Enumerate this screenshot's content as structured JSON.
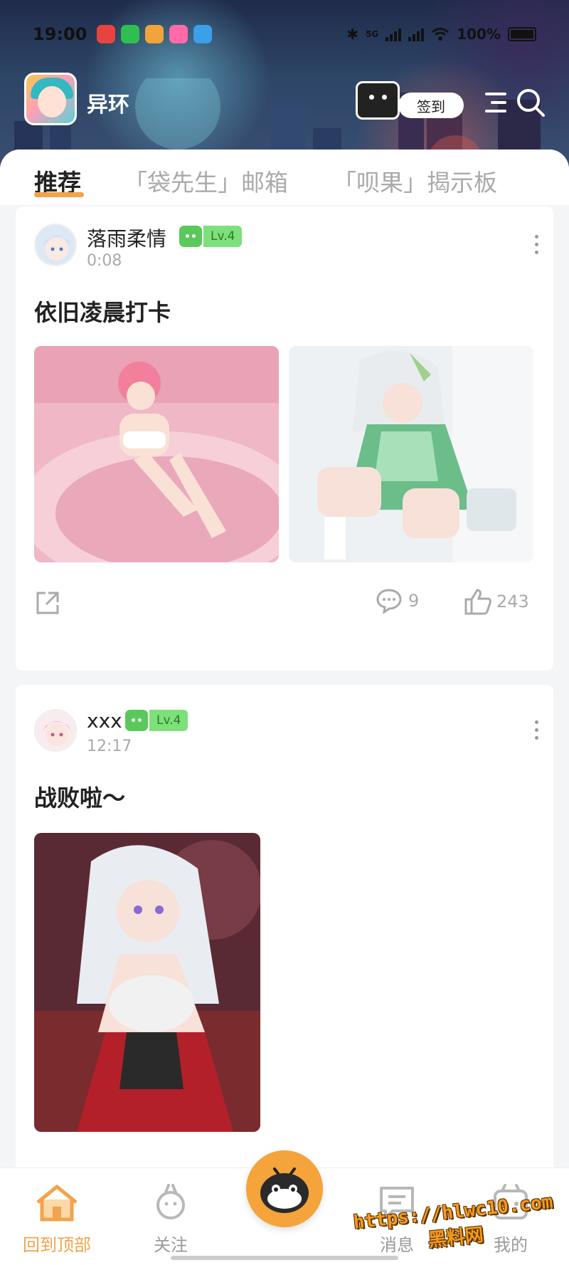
{
  "status_bar": {
    "time": "19:00",
    "network": "5G",
    "battery": "100%",
    "app_icon_colors": [
      "#e8433f",
      "#2fbf4f",
      "#f0a43a",
      "#ff6aa8",
      "#3aa0e8"
    ]
  },
  "header": {
    "app_name": "异环",
    "checkin_label": "签到",
    "menu_icon": "menu-icon",
    "search_icon": "search-icon"
  },
  "tabs": [
    {
      "label": "推荐",
      "active": true
    },
    {
      "label": "「袋先生」邮箱",
      "active": false
    },
    {
      "label": "「呗果」揭示板",
      "active": false
    }
  ],
  "posts": [
    {
      "username": "落雨柔情",
      "level": "Lv.4",
      "time": "0:08",
      "title": "依旧凌晨打卡",
      "image_count": 2,
      "comments": "9",
      "likes": "243"
    },
    {
      "username": "xxx",
      "level": "Lv.4",
      "time": "12:17",
      "title": "战败啦～",
      "image_count": 1
    }
  ],
  "bottom_nav": [
    {
      "label": "回到顶部",
      "icon": "home-icon",
      "active": true
    },
    {
      "label": "关注",
      "icon": "follow-icon",
      "active": false
    },
    {
      "label": "",
      "icon": "mascot-post-icon",
      "active": false
    },
    {
      "label": "消息",
      "icon": "message-icon",
      "active": false
    },
    {
      "label": "我的",
      "icon": "profile-icon",
      "active": false
    }
  ],
  "watermark": {
    "url": "https://hlwc10.com",
    "name": "黑料网"
  },
  "colors": {
    "accent": "#f2a34b",
    "level_badge": "#7de07b",
    "muted": "#aaaaaa"
  }
}
